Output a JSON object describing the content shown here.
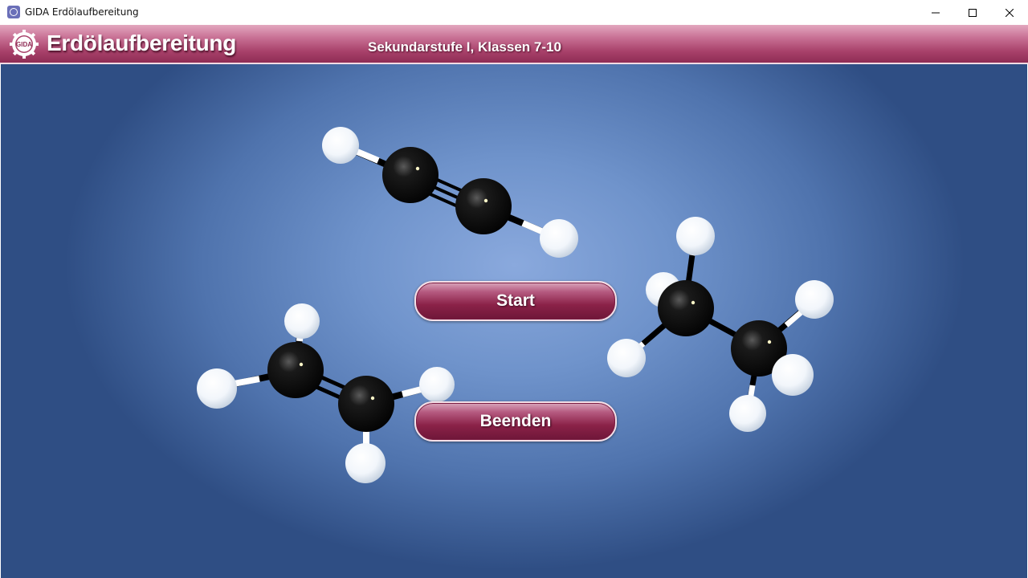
{
  "window": {
    "title": "GIDA Erdölaufbereitung",
    "controls": {
      "minimize_icon": "minimize-icon",
      "maximize_icon": "maximize-icon",
      "close_icon": "close-icon"
    }
  },
  "header": {
    "logo_icon": "gida-gear-logo-icon",
    "title": "Erdölaufbereitung",
    "subtitle": "Sekundarstufe I, Klassen 7-10",
    "colors": {
      "header_top": "#e3a7bf",
      "header_bottom": "#8f2d55"
    }
  },
  "menu": {
    "start_label": "Start",
    "quit_label": "Beenden"
  },
  "illustrations": [
    "ethyne-molecule",
    "ethene-molecule",
    "ethane-molecule"
  ],
  "colors": {
    "background_center": "#8aa9dd",
    "background_edge": "#2f4e84",
    "button": "#8b2248"
  }
}
